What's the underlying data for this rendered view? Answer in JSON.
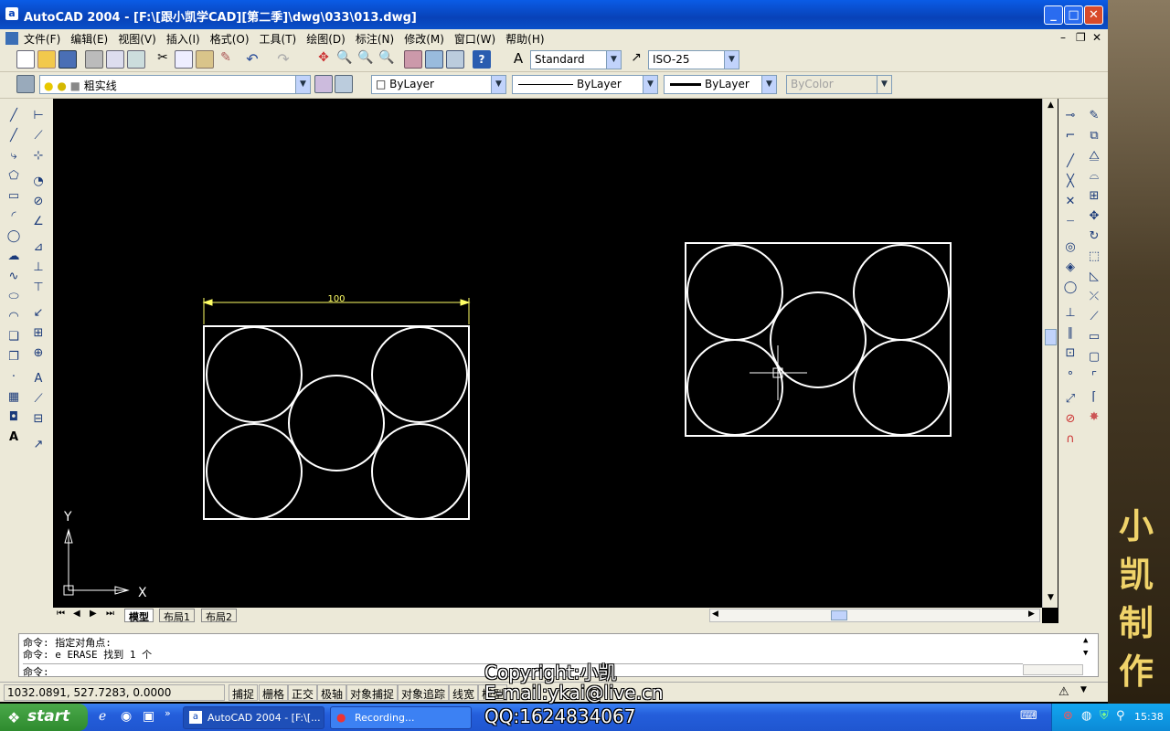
{
  "window": {
    "title": "AutoCAD 2004 - [F:\\[跟小凯学CAD][第二季]\\dwg\\033\\013.dwg]",
    "icon": "autocad-icon",
    "min_glyph": "_",
    "max_glyph": "□",
    "close_glyph": "✕"
  },
  "menu": {
    "items": [
      "文件(F)",
      "编辑(E)",
      "视图(V)",
      "插入(I)",
      "格式(O)",
      "工具(T)",
      "绘图(D)",
      "标注(N)",
      "修改(M)",
      "窗口(W)",
      "帮助(H)"
    ],
    "doc_min": "–",
    "doc_restore": "❐",
    "doc_close": "✕"
  },
  "toolbar": {
    "text_style": "Standard",
    "dim_style": "ISO-25",
    "layer": "粗实线",
    "color": "ByLayer",
    "linetype": "ByLayer",
    "lineweight": "ByLayer",
    "plotstyle": "ByColor"
  },
  "drawing": {
    "dimension_value": "100",
    "ucs_x": "X",
    "ucs_y": "Y",
    "background": "#000000",
    "linecolor": "#ffffff",
    "dimcolor": "#ffff66"
  },
  "tabs": [
    "模型",
    "布局1",
    "布局2"
  ],
  "command": {
    "line1": "命令: 指定对角点:",
    "line2": "命令: e ERASE 找到 1 个",
    "prompt": "命令:"
  },
  "status": {
    "coords": "1032.0891, 527.7283, 0.0000",
    "toggles": [
      "捕捉",
      "栅格",
      "正交",
      "极轴",
      "对象捕捉",
      "对象追踪",
      "线宽",
      "模型"
    ]
  },
  "taskbar": {
    "start": "start",
    "tasks": [
      "AutoCAD 2004 - [F:\\[...",
      "Recording..."
    ],
    "clock": "15:38"
  },
  "watermark": {
    "copyright": "Copyright:小凯",
    "email": "E-mail:ykai@live.cn",
    "qq": "QQ:1624834067"
  },
  "side_banner": [
    "小",
    "凯",
    "制",
    "作"
  ]
}
